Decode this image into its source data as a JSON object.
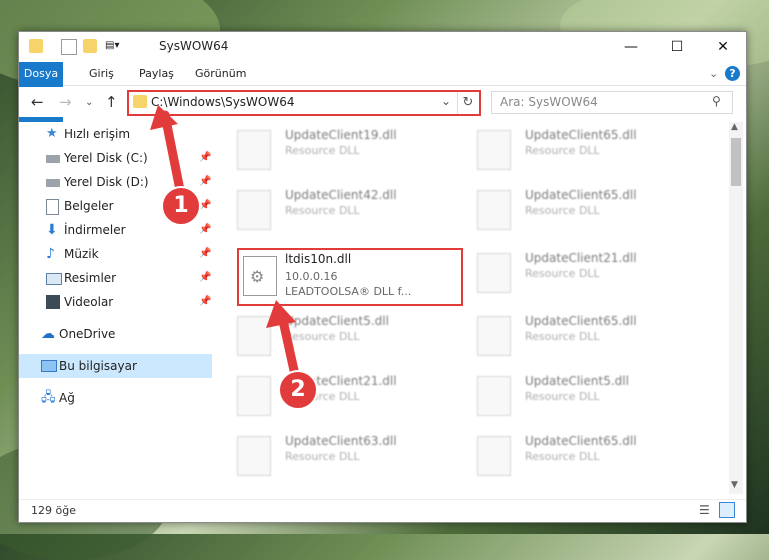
{
  "window": {
    "title": "SysWOW64"
  },
  "ribbon": {
    "tabs": [
      "Dosya",
      "Giriş",
      "Paylaş",
      "Görünüm"
    ]
  },
  "nav": {
    "address": "C:\\Windows\\SysWOW64",
    "search_placeholder": "Ara: SysWOW64"
  },
  "sidebar": {
    "items": [
      {
        "label": "Hızlı erişim",
        "icon": "star-icon"
      },
      {
        "label": "Yerel Disk (C:)",
        "icon": "drive-icon",
        "pinned": true
      },
      {
        "label": "Yerel Disk (D:)",
        "icon": "drive-icon",
        "pinned": true
      },
      {
        "label": "Belgeler",
        "icon": "documents-icon",
        "pinned": true
      },
      {
        "label": "İndirmeler",
        "icon": "download-icon",
        "pinned": true
      },
      {
        "label": "Müzik",
        "icon": "music-icon",
        "pinned": true
      },
      {
        "label": "Resimler",
        "icon": "pictures-icon",
        "pinned": true
      },
      {
        "label": "Videolar",
        "icon": "videos-icon",
        "pinned": true
      },
      {
        "label": "OneDrive",
        "icon": "cloud-icon"
      },
      {
        "label": "Bu bilgisayar",
        "icon": "computer-icon",
        "selected": true
      },
      {
        "label": "Ağ",
        "icon": "network-icon"
      }
    ]
  },
  "files": {
    "left": [
      {
        "name": "UpdateClient19.dll",
        "sub": "Resource DLL"
      },
      {
        "name": "UpdateClient42.dll",
        "sub": "Resource DLL"
      },
      {
        "name": "ltdis10n.dll",
        "sub": "10.0.0.16",
        "sub2": "LEADTOOLSA® DLL f...",
        "highlighted": true
      },
      {
        "name": "UpdateClient5.dll",
        "sub": "Resource DLL"
      },
      {
        "name": "UpdateClient21.dll",
        "sub": "Resource DLL"
      },
      {
        "name": "UpdateClient63.dll",
        "sub": "Resource DLL"
      }
    ],
    "right": [
      {
        "name": "UpdateClient65.dll",
        "sub": "Resource DLL"
      },
      {
        "name": "UpdateClient65.dll",
        "sub": "Resource DLL"
      },
      {
        "name": "UpdateClient21.dll",
        "sub": "Resource DLL"
      },
      {
        "name": "UpdateClient65.dll",
        "sub": "Resource DLL"
      },
      {
        "name": "UpdateClient5.dll",
        "sub": "Resource DLL"
      },
      {
        "name": "UpdateClient65.dll",
        "sub": "Resource DLL"
      }
    ]
  },
  "status": {
    "count": "129 öğe"
  },
  "callouts": [
    "1",
    "2"
  ],
  "colors": {
    "accent": "#1979ca",
    "highlight": "#e23b3b",
    "selected": "#cce8ff"
  }
}
